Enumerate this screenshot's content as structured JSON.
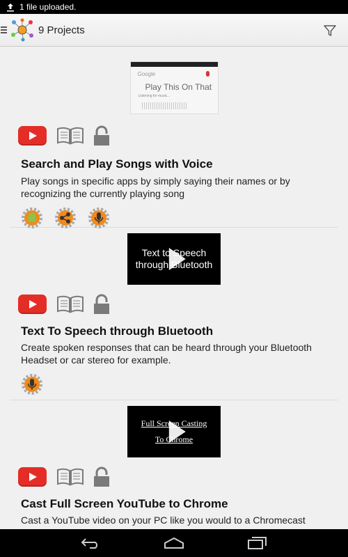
{
  "status_bar": {
    "notification": "1 file uploaded.",
    "icon": "upload-icon"
  },
  "action_bar": {
    "title": "9 Projects",
    "filter_icon": "filter-icon",
    "menu_icon": "hamburger-icon",
    "logo_icon": "app-logo-icon"
  },
  "projects": [
    {
      "thumbnail": {
        "kind": "google-voice-screenshot",
        "logo": "Google",
        "main_text": "Play This On That",
        "sub_text": "Listening for music..."
      },
      "title": "Search and Play Songs with Voice",
      "description": "Play songs in specific apps by simply saying their names or by recognizing the currently playing song",
      "uses": [
        "android-gear-icon",
        "share-gear-icon",
        "mic-gear-icon"
      ]
    },
    {
      "thumbnail": {
        "kind": "video",
        "line1": "Text to Speech",
        "line2": "through Bluetooth"
      },
      "title": "Text To Speech through Bluetooth",
      "description": "Create spoken responses that can be heard through your Bluetooth Headset or car stereo for example.",
      "uses": [
        "mic-gear-icon"
      ]
    },
    {
      "thumbnail": {
        "kind": "video",
        "line1": "Full Screen Casting",
        "line2": "To Chrome"
      },
      "title": "Cast Full Screen YouTube to Chrome",
      "description": "Cast a YouTube video on your PC like you would to a Chromecast",
      "uses": []
    }
  ],
  "colors": {
    "youtube_red": "#e52d27",
    "gear_orange": "#f08a1c",
    "icon_gray": "#7a7a7a"
  },
  "nav_bar": {
    "back": "back-icon",
    "home": "home-icon",
    "recents": "recents-icon"
  }
}
